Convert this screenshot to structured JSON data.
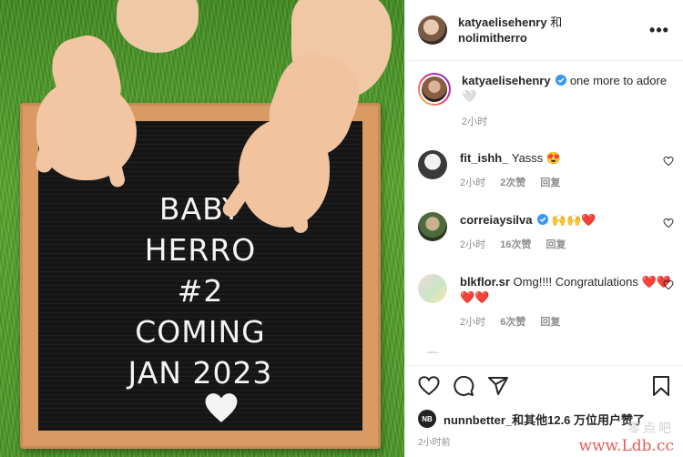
{
  "photo": {
    "board_lines": [
      "BABY",
      "HERRO",
      "#2",
      "COMING",
      "JAN 2023"
    ],
    "heart_glyph": "heart"
  },
  "header": {
    "user1": "katyaelisehenry",
    "joiner": " 和",
    "user2": "nolimitherro",
    "more_glyph": "•••"
  },
  "caption": {
    "username": "katyaelisehenry",
    "text": "one more to adore 🤍",
    "time": "2小时"
  },
  "comments": [
    {
      "username": "fit_ishh_",
      "text": "Yasss 😍",
      "time": "2小时",
      "likes": "2次赞",
      "reply": "回复"
    },
    {
      "username": "correiaysilva",
      "text": "🙌🙌❤️",
      "time": "2小时",
      "likes": "16次赞",
      "reply": "回复",
      "verified": true
    },
    {
      "username": "blkflor.sr",
      "text": "Omg!!!! Congratulations ❤️❤️❤️❤️",
      "time": "2小时",
      "likes": "6次赞",
      "reply": "回复"
    }
  ],
  "likes": {
    "avatar_text": "NB",
    "text": "nunnbetter_和其他12.6 万位用户赞了"
  },
  "time_ago": "2小时前",
  "watermark": {
    "cn": "零点吧",
    "url": "www.Ldb.cc"
  },
  "colors": {
    "verified": "#3897f0",
    "heart_red": "#ed4956",
    "grass": "#4a9624",
    "felt": "#151515",
    "frame": "#d99b63"
  }
}
